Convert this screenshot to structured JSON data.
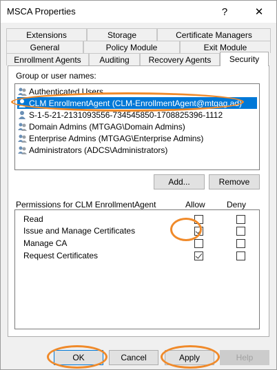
{
  "window": {
    "title": "MSCA Properties",
    "help_glyph": "?",
    "close_glyph": "✕"
  },
  "tabs": {
    "row1": [
      "Extensions",
      "Storage",
      "Certificate Managers"
    ],
    "row2": [
      "General",
      "Policy Module",
      "Exit Module"
    ],
    "row3": [
      "Enrollment Agents",
      "Auditing",
      "Recovery Agents",
      "Security"
    ],
    "active": "Security"
  },
  "security": {
    "group_label": "Group or user names:",
    "users": [
      "Authenticated Users",
      "CLM EnrollmentAgent (CLM-EnrollmentAgent@mtgag.ad)",
      "S-1-5-21-2131093556-734545850-1708825396-1112",
      "Domain Admins (MTGAG\\Domain Admins)",
      "Enterprise Admins (MTGAG\\Enterprise Admins)",
      "Administrators (ADCS\\Administrators)"
    ],
    "selected_index": 1,
    "add_label": "Add...",
    "remove_label": "Remove",
    "permissions_label": "Permissions for CLM EnrollmentAgent",
    "allow_label": "Allow",
    "deny_label": "Deny",
    "permissions": [
      {
        "name": "Read",
        "allow": false,
        "deny": false
      },
      {
        "name": "Issue and Manage Certificates",
        "allow": true,
        "deny": false
      },
      {
        "name": "Manage CA",
        "allow": false,
        "deny": false
      },
      {
        "name": "Request Certificates",
        "allow": true,
        "deny": false
      }
    ]
  },
  "footer": {
    "ok_label": "OK",
    "cancel_label": "Cancel",
    "apply_label": "Apply",
    "help_label": "Help"
  },
  "highlight_color": "#f08a2a",
  "selection_color": "#0078d7"
}
